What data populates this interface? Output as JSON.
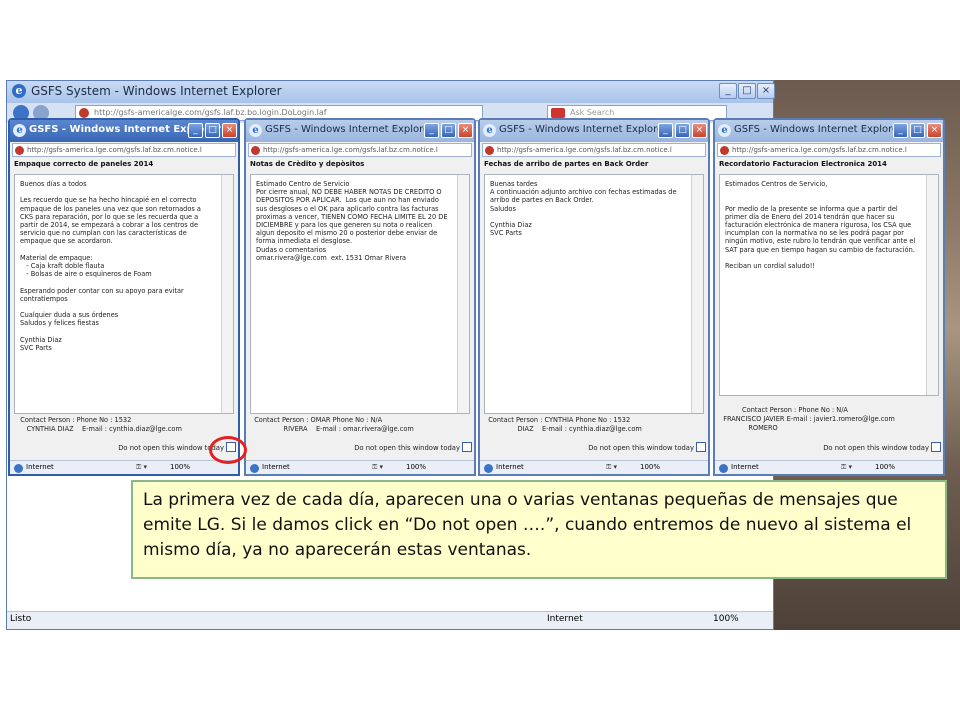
{
  "main_window": {
    "title": "GSFS System - Windows Internet Explorer",
    "url": "http://gsfs-americalge.com/gsfs.laf.bz.bo.login.DoLogin.laf",
    "search_placeholder": "Ask Search",
    "status_left": "Listo",
    "status_zone": "Internet",
    "status_zoom": "100%"
  },
  "popups": [
    {
      "title": "GSFS - Windows Internet Explorer",
      "url": "http://gsfs-america.lge.com/gsfs.laf.bz.cm.notice.l",
      "heading": "Empaque correcto de paneles 2014",
      "message": "Buenos días a todos\n\nLes recuerdo que se ha hecho hincapié en el correcto empaque de los paneles una vez que son retornados a CKS para reparación, por lo que se les recuerda que a partir de 2014, se empezará a cobrar a los centros de servicio que no cumplan con las características de empaque que se acordaron.\n\nMaterial de empaque:\n   - Caja kraft doble flauta\n   - Bolsas de aire o esquineros de Foam\n\nEsperando poder contar con su apoyo para evitar contratiempos\n\nCualquier duda a sus órdenes\nSaludos y felices fiestas\n\nCynthia Diaz\nSVC Parts",
      "contact": "   Contact Person : Phone No : 1532\n      CYNTHIA DIAZ    E-mail : cynthia.diaz@lge.com",
      "do_not_open": "Do not open this window today",
      "zone": "Internet",
      "zoom": "100%",
      "active": true
    },
    {
      "title": "GSFS - Windows Internet Explorer",
      "url": "http://gsfs-america.lge.com/gsfs.laf.bz.cm.notice.l",
      "heading": "Notas de Crèdito y depòsitos",
      "message": "Estimado Centro de Servicio\nPor cierre anual, NO DEBE HABER NOTAS DE CREDITO O DEPOSITOS POR APLICAR.  Los que aun no han enviado sus desgloses o el OK para aplicarlo contra las facturas proximas a vencer, TIENEN COMO FECHA LIMITE EL 20 DE DICIEMBRE y para los que generen su nota o realicen algun deposito el mismo 20 o posterior debe enviar de forma inmediata el desglose.\nDudas o comentarios\nomar.rivera@lge.com  ext. 1531 Omar Rivera",
      "contact": "  Contact Person : OMAR Phone No : N/A\n                RIVERA    E-mail : omar.rivera@lge.com",
      "do_not_open": "Do not open this window today",
      "zone": "Internet",
      "zoom": "100%",
      "active": false
    },
    {
      "title": "GSFS - Windows Internet Explorer",
      "url": "http://gsfs-america.lge.com/gsfs.laf.bz.cm.notice.l",
      "heading": "Fechas de arribo de partes en Back Order",
      "message": "Buenas tardes\nA continuación adjunto archivo con fechas estimadas de arribo de partes en Back Order.\nSaludos\n\nCynthia Diaz\nSVC Parts",
      "contact": "  Contact Person : CYNTHIA Phone No : 1532\n                DIAZ    E-mail : cynthia.diaz@lge.com",
      "do_not_open": "Do not open this window today",
      "zone": "Internet",
      "zoom": "100%",
      "active": false
    },
    {
      "title": "GSFS - Windows Internet Explorer",
      "url": "http://gsfs-america.lge.com/gsfs.laf.bz.cm.notice.l",
      "heading": "Recordatorio Facturacion Electronica 2014",
      "message": "Estimados Centros de Servicio,\n\n\nPor medio de la presente se informa que a partir del primer día de Enero del 2014 tendrán que hacer su facturación electrónica de manera rigurosa, los CSA que incumplan con la normativa no se les podrá pagar por ningún motivo, este rubro lo tendrán que verificar ante el SAT para que en tiempo hagan su cambio de facturación.\n\nReciban un cordial saludo!!",
      "contact": "           Contact Person : Phone No : N/A\n  FRANCISCO JAVIER E-mail : javier1.romero@lge.com\n              ROMERO",
      "do_not_open": "Do not open this window today",
      "zone": "Internet",
      "zoom": "100%",
      "active": false
    }
  ],
  "caption": "La primera vez de cada día, aparecen una o varias ventanas pequeñas de mensajes que emite LG. Si le damos click en “Do not open ….”, cuando entremos de nuevo al sistema el mismo día, ya no aparecerán estas ventanas."
}
